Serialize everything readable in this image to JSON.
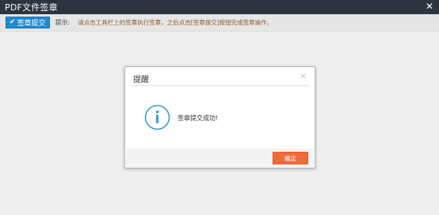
{
  "window": {
    "title": "PDF文件签章",
    "close_glyph": "✕"
  },
  "toolbar": {
    "submit_label": "签章提交",
    "hint_label": "提示:",
    "hint_text": "请点击工具栏上的签章执行签章，之后点击[签章提交]按钮完成签章操作。"
  },
  "dialog": {
    "title": "提醒",
    "close_glyph": "×",
    "message": "签章提交成功!",
    "ok_label": "确定",
    "icon": "info-circle-icon"
  },
  "colors": {
    "titlebar": "#2c3440",
    "submit_button": "#1e8ad2",
    "info_icon": "#3a9bd5",
    "ok_button": "#f06b3c"
  }
}
